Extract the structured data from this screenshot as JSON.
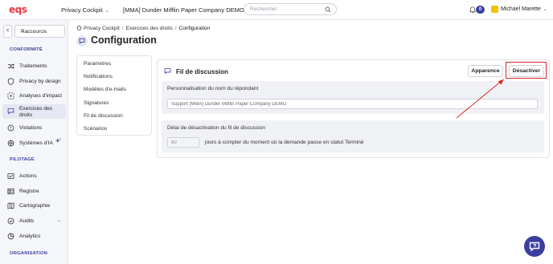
{
  "topbar": {
    "logo": "eqs",
    "product": "Privacy Cockpit",
    "company": "[MMA] Dunder Mifflin Paper Company DEMO",
    "search_placeholder": "Rechercher",
    "notifications_count": "0",
    "user_name": "Michael Marette"
  },
  "sidebar": {
    "collapse_glyph": "<",
    "shortcuts_label": "Raccourcis",
    "sections": {
      "conformite": "CONFORMITÉ",
      "pilotage": "PILOTAGE",
      "organisation": "ORGANISATION"
    },
    "items": [
      {
        "label": "Traitements",
        "icon": "shuffle-icon"
      },
      {
        "label": "Privacy by design",
        "icon": "shield-icon"
      },
      {
        "label": "Analyses d'impact",
        "icon": "target-icon"
      },
      {
        "label": "Exercices des droits",
        "icon": "chat-icon",
        "active": true
      },
      {
        "label": "Violations",
        "icon": "alert-icon"
      },
      {
        "label": "Systèmes d'IA",
        "icon": "ai-icon"
      },
      {
        "label": "Actions",
        "icon": "actions-icon"
      },
      {
        "label": "Registre",
        "icon": "register-icon"
      },
      {
        "label": "Cartographie",
        "icon": "map-icon"
      },
      {
        "label": "Audits",
        "icon": "audit-icon"
      },
      {
        "label": "Analytics",
        "icon": "analytics-icon"
      }
    ]
  },
  "breadcrumb": {
    "items": [
      "Privacy Cockpit",
      "Exercices des droits",
      "Configuration"
    ],
    "separator": "/"
  },
  "page": {
    "title": "Configuration"
  },
  "settings_menu": {
    "items": [
      "Paramètres",
      "Notifications",
      "Modèles d'e-mails",
      "Signatures",
      "Fil de discussion",
      "Scénarios"
    ]
  },
  "panel": {
    "title": "Fil de discussion",
    "appearance_button": "Apparence",
    "disable_button": "Désactiver",
    "respondent_name": {
      "label": "Personnalisation du nom du répondant",
      "value": "Support [MMA] Dunder Mifflin Paper Company DEMO"
    },
    "deactivation_delay": {
      "label": "Délai de désactivation du fil de discussion",
      "value": "90",
      "suffix": "jours à compter du moment où la demande passe en statut Terminé"
    }
  },
  "colors": {
    "brand_red": "#e8393f",
    "accent": "#3a3f9e",
    "highlight": "#d9262c"
  }
}
